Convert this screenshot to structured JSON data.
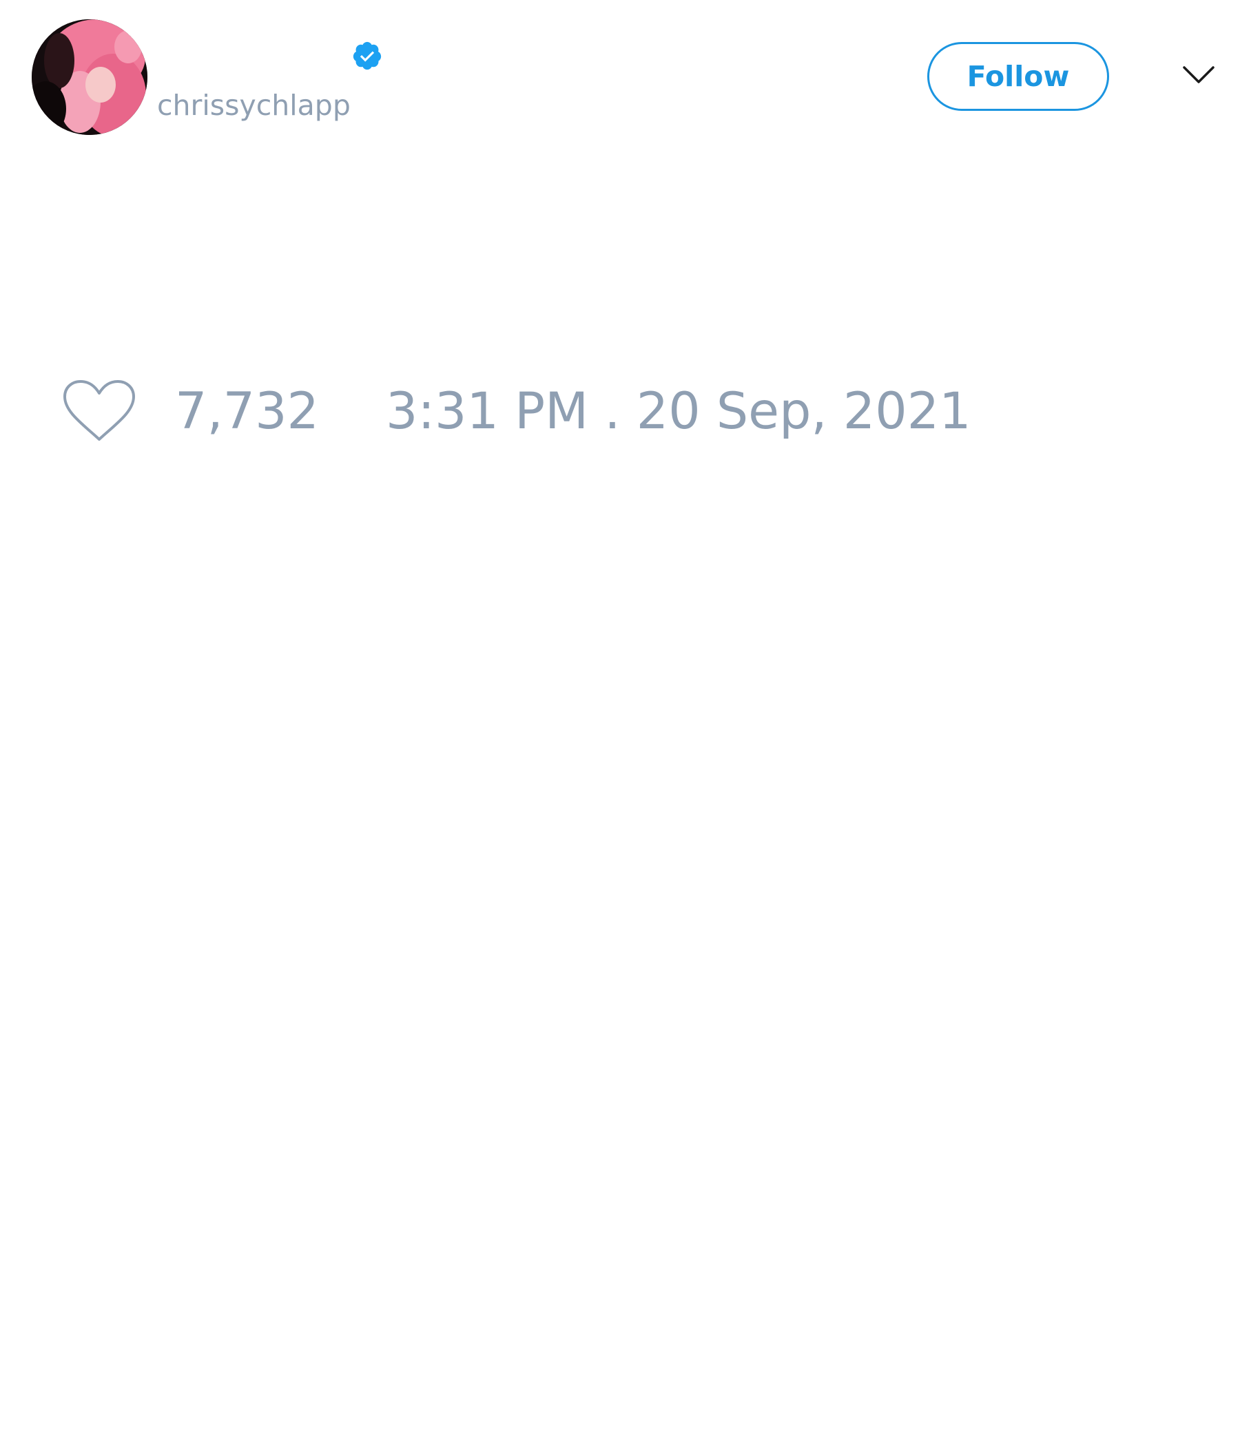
{
  "author": {
    "display_name": "",
    "handle": "chrissychlapp",
    "verified": true,
    "avatar": "profile-photo-pink-hair"
  },
  "header": {
    "follow_label": "Follow",
    "menu_icon": "chevron-down-icon"
  },
  "tweet": {
    "like_icon": "heart-outline-icon",
    "like_count": "7,732",
    "timestamp": "3:31 PM . 20 Sep, 2021"
  },
  "colors": {
    "accent": "#1b95e0",
    "muted_text": "#8f9fb2",
    "background": "#ffffff"
  }
}
